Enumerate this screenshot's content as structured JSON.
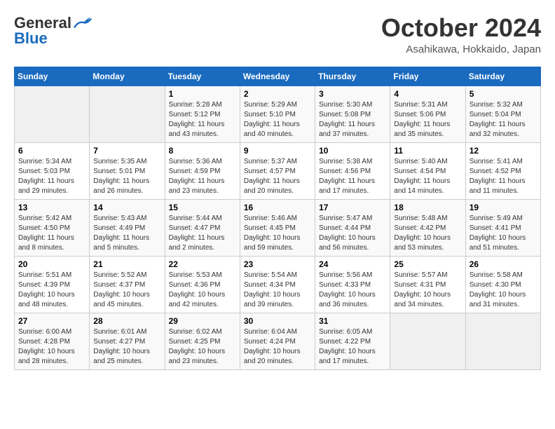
{
  "logo": {
    "general": "General",
    "blue": "Blue"
  },
  "header": {
    "month": "October 2024",
    "location": "Asahikawa, Hokkaido, Japan"
  },
  "weekdays": [
    "Sunday",
    "Monday",
    "Tuesday",
    "Wednesday",
    "Thursday",
    "Friday",
    "Saturday"
  ],
  "weeks": [
    [
      {
        "day": "",
        "empty": true
      },
      {
        "day": "",
        "empty": true
      },
      {
        "day": "1",
        "sunrise": "5:28 AM",
        "sunset": "5:12 PM",
        "daylight": "11 hours and 43 minutes."
      },
      {
        "day": "2",
        "sunrise": "5:29 AM",
        "sunset": "5:10 PM",
        "daylight": "11 hours and 40 minutes."
      },
      {
        "day": "3",
        "sunrise": "5:30 AM",
        "sunset": "5:08 PM",
        "daylight": "11 hours and 37 minutes."
      },
      {
        "day": "4",
        "sunrise": "5:31 AM",
        "sunset": "5:06 PM",
        "daylight": "11 hours and 35 minutes."
      },
      {
        "day": "5",
        "sunrise": "5:32 AM",
        "sunset": "5:04 PM",
        "daylight": "11 hours and 32 minutes."
      }
    ],
    [
      {
        "day": "6",
        "sunrise": "5:34 AM",
        "sunset": "5:03 PM",
        "daylight": "11 hours and 29 minutes."
      },
      {
        "day": "7",
        "sunrise": "5:35 AM",
        "sunset": "5:01 PM",
        "daylight": "11 hours and 26 minutes."
      },
      {
        "day": "8",
        "sunrise": "5:36 AM",
        "sunset": "4:59 PM",
        "daylight": "11 hours and 23 minutes."
      },
      {
        "day": "9",
        "sunrise": "5:37 AM",
        "sunset": "4:57 PM",
        "daylight": "11 hours and 20 minutes."
      },
      {
        "day": "10",
        "sunrise": "5:38 AM",
        "sunset": "4:56 PM",
        "daylight": "11 hours and 17 minutes."
      },
      {
        "day": "11",
        "sunrise": "5:40 AM",
        "sunset": "4:54 PM",
        "daylight": "11 hours and 14 minutes."
      },
      {
        "day": "12",
        "sunrise": "5:41 AM",
        "sunset": "4:52 PM",
        "daylight": "11 hours and 11 minutes."
      }
    ],
    [
      {
        "day": "13",
        "sunrise": "5:42 AM",
        "sunset": "4:50 PM",
        "daylight": "11 hours and 8 minutes."
      },
      {
        "day": "14",
        "sunrise": "5:43 AM",
        "sunset": "4:49 PM",
        "daylight": "11 hours and 5 minutes."
      },
      {
        "day": "15",
        "sunrise": "5:44 AM",
        "sunset": "4:47 PM",
        "daylight": "11 hours and 2 minutes."
      },
      {
        "day": "16",
        "sunrise": "5:46 AM",
        "sunset": "4:45 PM",
        "daylight": "10 hours and 59 minutes."
      },
      {
        "day": "17",
        "sunrise": "5:47 AM",
        "sunset": "4:44 PM",
        "daylight": "10 hours and 56 minutes."
      },
      {
        "day": "18",
        "sunrise": "5:48 AM",
        "sunset": "4:42 PM",
        "daylight": "10 hours and 53 minutes."
      },
      {
        "day": "19",
        "sunrise": "5:49 AM",
        "sunset": "4:41 PM",
        "daylight": "10 hours and 51 minutes."
      }
    ],
    [
      {
        "day": "20",
        "sunrise": "5:51 AM",
        "sunset": "4:39 PM",
        "daylight": "10 hours and 48 minutes."
      },
      {
        "day": "21",
        "sunrise": "5:52 AM",
        "sunset": "4:37 PM",
        "daylight": "10 hours and 45 minutes."
      },
      {
        "day": "22",
        "sunrise": "5:53 AM",
        "sunset": "4:36 PM",
        "daylight": "10 hours and 42 minutes."
      },
      {
        "day": "23",
        "sunrise": "5:54 AM",
        "sunset": "4:34 PM",
        "daylight": "10 hours and 39 minutes."
      },
      {
        "day": "24",
        "sunrise": "5:56 AM",
        "sunset": "4:33 PM",
        "daylight": "10 hours and 36 minutes."
      },
      {
        "day": "25",
        "sunrise": "5:57 AM",
        "sunset": "4:31 PM",
        "daylight": "10 hours and 34 minutes."
      },
      {
        "day": "26",
        "sunrise": "5:58 AM",
        "sunset": "4:30 PM",
        "daylight": "10 hours and 31 minutes."
      }
    ],
    [
      {
        "day": "27",
        "sunrise": "6:00 AM",
        "sunset": "4:28 PM",
        "daylight": "10 hours and 28 minutes."
      },
      {
        "day": "28",
        "sunrise": "6:01 AM",
        "sunset": "4:27 PM",
        "daylight": "10 hours and 25 minutes."
      },
      {
        "day": "29",
        "sunrise": "6:02 AM",
        "sunset": "4:25 PM",
        "daylight": "10 hours and 23 minutes."
      },
      {
        "day": "30",
        "sunrise": "6:04 AM",
        "sunset": "4:24 PM",
        "daylight": "10 hours and 20 minutes."
      },
      {
        "day": "31",
        "sunrise": "6:05 AM",
        "sunset": "4:22 PM",
        "daylight": "10 hours and 17 minutes."
      },
      {
        "day": "",
        "empty": true
      },
      {
        "day": "",
        "empty": true
      }
    ]
  ],
  "labels": {
    "sunrise": "Sunrise:",
    "sunset": "Sunset:",
    "daylight": "Daylight:"
  }
}
